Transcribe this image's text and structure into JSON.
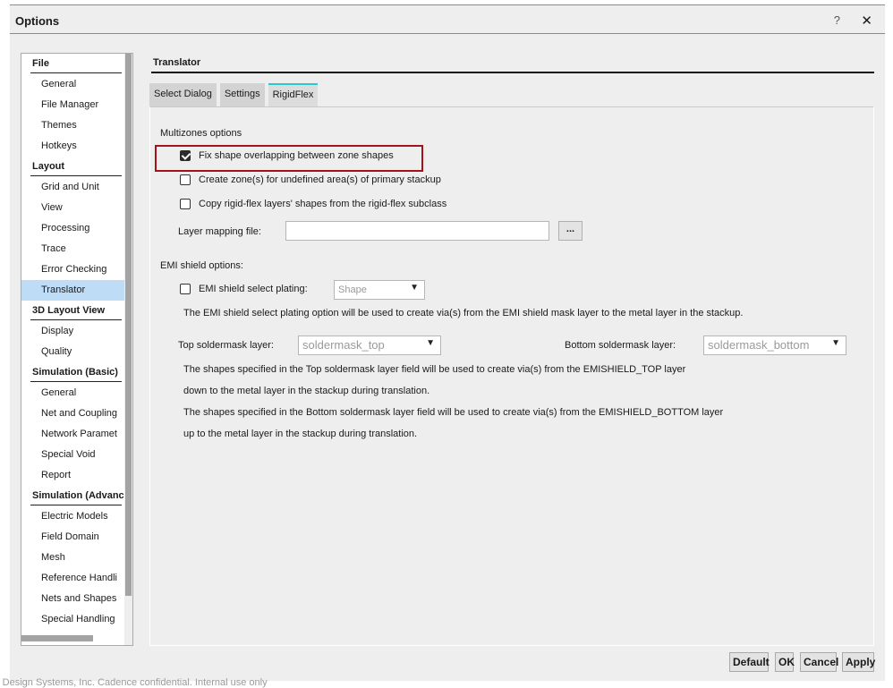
{
  "window": {
    "title": "Options",
    "help_label": "?",
    "close_label": "✕"
  },
  "sidebar": {
    "entries": [
      {
        "type": "category",
        "label": "File"
      },
      {
        "type": "item",
        "label": "General"
      },
      {
        "type": "item",
        "label": "File Manager"
      },
      {
        "type": "item",
        "label": "Themes"
      },
      {
        "type": "item",
        "label": "Hotkeys"
      },
      {
        "type": "category",
        "label": "Layout"
      },
      {
        "type": "item",
        "label": "Grid and Unit"
      },
      {
        "type": "item",
        "label": "View"
      },
      {
        "type": "item",
        "label": "Processing"
      },
      {
        "type": "item",
        "label": "Trace"
      },
      {
        "type": "item",
        "label": "Error Checking"
      },
      {
        "type": "item",
        "label": "Translator",
        "selected": true
      },
      {
        "type": "category",
        "label": "3D Layout View"
      },
      {
        "type": "item",
        "label": "Display"
      },
      {
        "type": "item",
        "label": "Quality"
      },
      {
        "type": "category",
        "label": "Simulation (Basic)"
      },
      {
        "type": "item",
        "label": "General"
      },
      {
        "type": "item",
        "label": "Net and Coupling"
      },
      {
        "type": "item",
        "label": "Network Paramet"
      },
      {
        "type": "item",
        "label": "Special Void"
      },
      {
        "type": "item",
        "label": "Report"
      },
      {
        "type": "category",
        "label": "Simulation (Advanc"
      },
      {
        "type": "item",
        "label": "Electric Models"
      },
      {
        "type": "item",
        "label": "Field Domain"
      },
      {
        "type": "item",
        "label": "Mesh"
      },
      {
        "type": "item",
        "label": "Reference Handli"
      },
      {
        "type": "item",
        "label": "Nets and Shapes"
      },
      {
        "type": "item",
        "label": "Special Handling"
      }
    ]
  },
  "main": {
    "section_title": "Translator",
    "tabs": [
      {
        "label": "Select Dialog",
        "active": false
      },
      {
        "label": "Settings",
        "active": false
      },
      {
        "label": "RigidFlex",
        "active": true
      }
    ],
    "multizones": {
      "heading": "Multizones options",
      "options": [
        {
          "label": "Fix shape overlapping between zone shapes",
          "checked": true
        },
        {
          "label": "Create zone(s) for undefined area(s) of primary stackup",
          "checked": false
        },
        {
          "label": "Copy rigid-flex layers' shapes from the rigid-flex subclass",
          "checked": false
        }
      ],
      "layer_mapping_label": "Layer mapping file:",
      "layer_mapping_value": "",
      "browse_label": "..."
    },
    "emi": {
      "heading": "EMI shield options:",
      "select_plating_label": "EMI shield select plating:",
      "select_plating_checked": false,
      "select_plating_value": "Shape",
      "plating_note": "The EMI shield select plating option will be used to create via(s) from the EMI shield mask layer to the metal layer in the stackup.",
      "top_label": "Top soldermask layer:",
      "top_value": "soldermask_top",
      "bottom_label": "Bottom soldermask layer:",
      "bottom_value": "soldermask_bottom",
      "notes": [
        "The shapes specified in the Top soldermask layer field will be used to create via(s) from the EMISHIELD_TOP layer",
        "down to the metal layer in the stackup during translation.",
        "The shapes specified in the Bottom soldermask layer field will be used to create via(s) from the EMISHIELD_BOTTOM layer",
        "up to the metal layer in the stackup during translation."
      ],
      "dropdown_arrow": "▼"
    }
  },
  "footer": {
    "default_label": "Default",
    "ok_label": "OK",
    "cancel_label": "Cancel",
    "apply_label": "Apply"
  },
  "watermark": "ce Design Systems, Inc. Cadence confidential. Internal use only"
}
